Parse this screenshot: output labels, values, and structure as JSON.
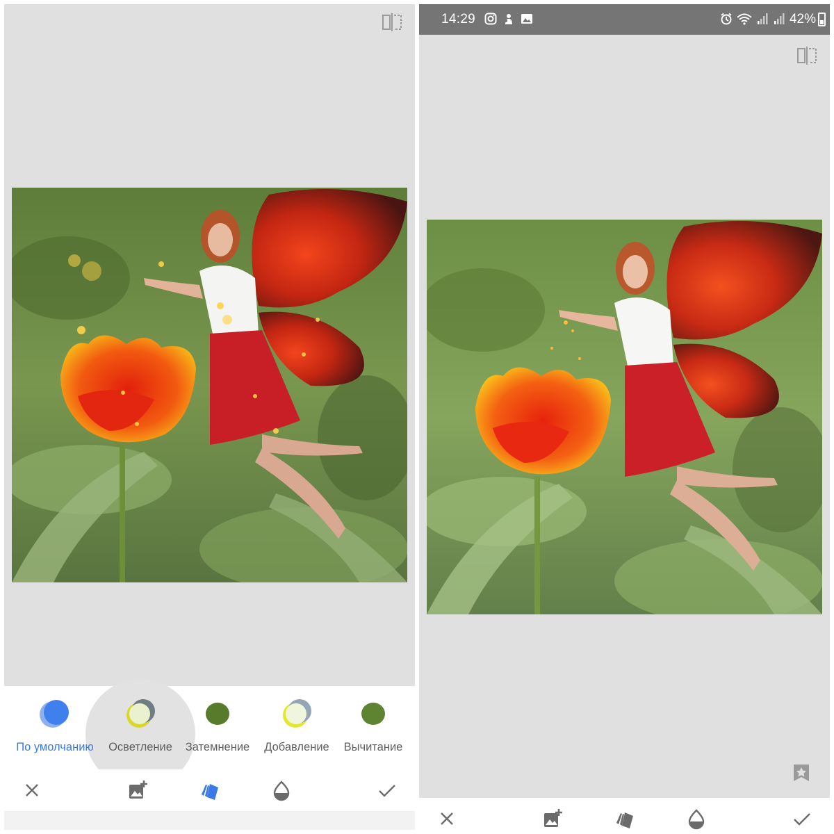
{
  "status_bar": {
    "time": "14:29",
    "battery": "42%",
    "left_icons": [
      "instagram-icon",
      "fingerprint-icon",
      "gallery-icon"
    ],
    "right_icons": [
      "alarm-icon",
      "wifi-icon",
      "signal-icon",
      "signal-icon-2"
    ]
  },
  "blend_modes": [
    {
      "label": "По умолчанию",
      "icon": "default-blend-icon",
      "selected": true
    },
    {
      "label": "Осветление",
      "icon": "lighten-blend-icon",
      "selected": false
    },
    {
      "label": "Затемнение",
      "icon": "darken-blend-icon",
      "selected": false
    },
    {
      "label": "Добавление",
      "icon": "add-blend-icon",
      "selected": false
    },
    {
      "label": "Вычитание",
      "icon": "subtract-blend-icon",
      "selected": false
    }
  ],
  "toolbar": {
    "cancel_icon": "close-icon",
    "add_image_icon": "add-image-icon",
    "blend_icon": "layers-icon",
    "opacity_icon": "opacity-icon",
    "apply_icon": "check-icon"
  },
  "colors": {
    "accent": "#3b7ae6",
    "canvas_bg": "#e0e0e0",
    "status_bar_bg": "#757575",
    "icon_gray": "#6b6b6b"
  }
}
